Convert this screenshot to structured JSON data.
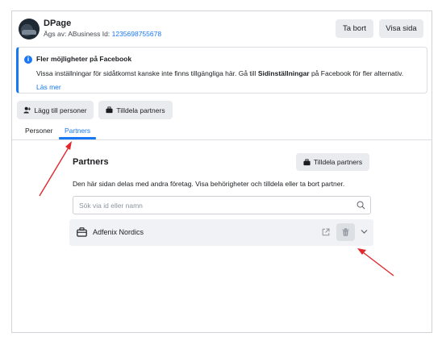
{
  "header": {
    "page_name": "DPage",
    "owner_prefix": "Ägs av: ABusiness",
    "id_label": "Id:",
    "id_value": "1235698755678",
    "remove_button": "Ta bort",
    "view_button": "Visa sida"
  },
  "banner": {
    "title": "Fler möjligheter på Facebook",
    "body_before": "Vissa inställningar för sidåtkomst kanske inte finns tillgängliga här. Gå till ",
    "body_bold": "Sidinställningar",
    "body_after": " på Facebook för fler alternativ.",
    "link": "Läs mer"
  },
  "actions": {
    "add_people": "Lägg till personer",
    "assign_partners": "Tilldela partners"
  },
  "tabs": [
    {
      "label": "Personer",
      "active": false
    },
    {
      "label": "Partners",
      "active": true
    }
  ],
  "partners": {
    "title": "Partners",
    "assign_button": "Tilldela partners",
    "description": "Den här sidan delas med andra företag. Visa behörigheter och tilldela eller ta bort partner.",
    "search_placeholder": "Sök via id eller namn",
    "rows": [
      {
        "name": "Adfenix Nordics"
      }
    ]
  },
  "colors": {
    "accent": "#1877f2",
    "annotation_arrow": "#e0282e"
  },
  "icons": [
    "info-icon",
    "person-icon",
    "briefcase-icon",
    "search-icon",
    "open-external-icon",
    "trash-icon",
    "chevron-down-icon"
  ]
}
